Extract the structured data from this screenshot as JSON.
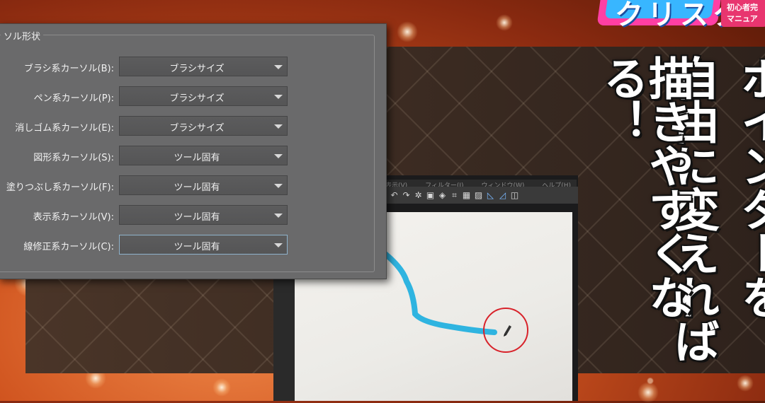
{
  "dialog": {
    "group_title": "ソル形状",
    "rows": [
      {
        "label": "ブラシ系カーソル(B):",
        "value": "ブラシサイズ"
      },
      {
        "label": "ペン系カーソル(P):",
        "value": "ブラシサイズ"
      },
      {
        "label": "消しゴム系カーソル(E):",
        "value": "ブラシサイズ"
      },
      {
        "label": "図形系カーソル(S):",
        "value": "ツール固有"
      },
      {
        "label": "塗りつぶし系カーソル(F):",
        "value": "ツール固有"
      },
      {
        "label": "表示系カーソル(V):",
        "value": "ツール固有"
      },
      {
        "label": "線修正系カーソル(C):",
        "value": "ツール固有"
      }
    ]
  },
  "photo": {
    "menu_items": [
      "表示(V)",
      "フィルター(I)",
      "ウィンドウ(W)",
      "ヘルプ(H)"
    ],
    "toolbar_icons": [
      "undo-icon",
      "redo-icon",
      "transform-icon",
      "selection-icon",
      "fill-icon",
      "crop-icon",
      "grid-icon",
      "ruler-icon",
      "snap-icon",
      "pen-snap-icon"
    ]
  },
  "logo": {
    "main": "クリスタ",
    "badge_line1": "初心者完",
    "badge_line2": "マニュア"
  },
  "headline": {
    "col1": "ポインターを",
    "col2": "自由に変えれば",
    "col3": "描きやすくなる！"
  },
  "colors": {
    "stroke": "#2fb4e0",
    "circle": "#d8222a",
    "dialog_bg": "#6a6a6b",
    "focus_border": "#8fb3cc"
  }
}
